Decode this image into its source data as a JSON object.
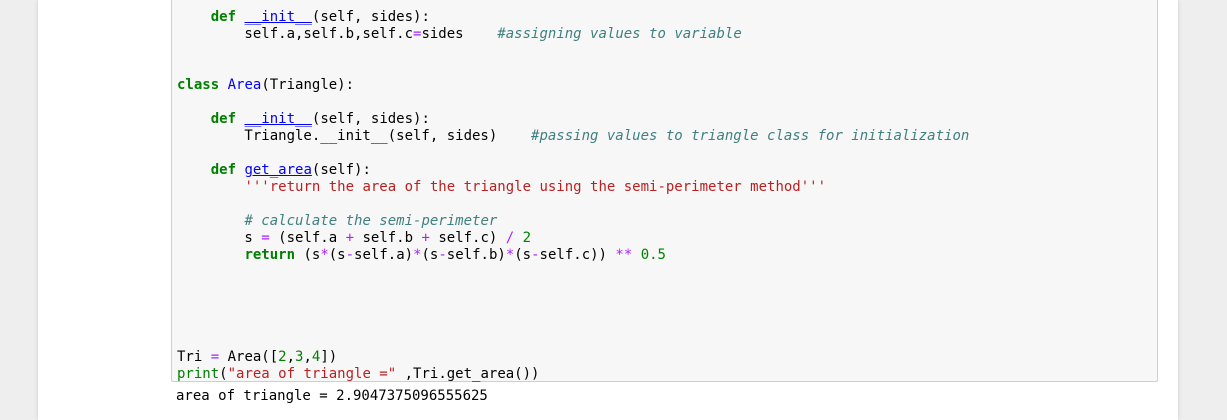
{
  "cell": {
    "lines": [
      {
        "segments": []
      },
      {
        "segments": [
          {
            "t": "    "
          },
          {
            "t": "def",
            "c": "kw"
          },
          {
            "t": " "
          },
          {
            "t": "__init__",
            "c": "fn"
          },
          {
            "t": "(self, sides):"
          }
        ]
      },
      {
        "segments": [
          {
            "t": "        self.a,self.b,self.c"
          },
          {
            "t": "=",
            "c": "op"
          },
          {
            "t": "sides    "
          },
          {
            "t": "#assigning values to variable",
            "c": "cm"
          }
        ]
      },
      {
        "segments": []
      },
      {
        "segments": []
      },
      {
        "segments": [
          {
            "t": "class",
            "c": "kw"
          },
          {
            "t": " "
          },
          {
            "t": "Area",
            "c": "nc"
          },
          {
            "t": "(Triangle):"
          }
        ]
      },
      {
        "segments": []
      },
      {
        "segments": [
          {
            "t": "    "
          },
          {
            "t": "def",
            "c": "kw"
          },
          {
            "t": " "
          },
          {
            "t": "__init__",
            "c": "fn"
          },
          {
            "t": "(self, sides):"
          }
        ]
      },
      {
        "segments": [
          {
            "t": "        Triangle.__init__(self, sides)    "
          },
          {
            "t": "#passing values to triangle class for initialization",
            "c": "cm"
          }
        ]
      },
      {
        "segments": []
      },
      {
        "segments": [
          {
            "t": "    "
          },
          {
            "t": "def",
            "c": "kw"
          },
          {
            "t": " "
          },
          {
            "t": "get_area",
            "c": "fn"
          },
          {
            "t": "(self):"
          }
        ]
      },
      {
        "segments": [
          {
            "t": "        "
          },
          {
            "t": "'''return the area of the triangle using the semi-perimeter method'''",
            "c": "st"
          }
        ]
      },
      {
        "segments": []
      },
      {
        "segments": [
          {
            "t": "        "
          },
          {
            "t": "# calculate the semi-perimeter",
            "c": "cm"
          }
        ]
      },
      {
        "segments": [
          {
            "t": "        s "
          },
          {
            "t": "=",
            "c": "op"
          },
          {
            "t": " (self.a "
          },
          {
            "t": "+",
            "c": "op"
          },
          {
            "t": " self.b "
          },
          {
            "t": "+",
            "c": "op"
          },
          {
            "t": " self.c) "
          },
          {
            "t": "/",
            "c": "op"
          },
          {
            "t": " "
          },
          {
            "t": "2",
            "c": "mi"
          }
        ]
      },
      {
        "segments": [
          {
            "t": "        "
          },
          {
            "t": "return",
            "c": "kw"
          },
          {
            "t": " (s"
          },
          {
            "t": "*",
            "c": "op"
          },
          {
            "t": "(s"
          },
          {
            "t": "-",
            "c": "op"
          },
          {
            "t": "self.a)"
          },
          {
            "t": "*",
            "c": "op"
          },
          {
            "t": "(s"
          },
          {
            "t": "-",
            "c": "op"
          },
          {
            "t": "self.b)"
          },
          {
            "t": "*",
            "c": "op"
          },
          {
            "t": "(s"
          },
          {
            "t": "-",
            "c": "op"
          },
          {
            "t": "self.c)) "
          },
          {
            "t": "**",
            "c": "op"
          },
          {
            "t": " "
          },
          {
            "t": "0.5",
            "c": "mi"
          }
        ]
      },
      {
        "segments": []
      },
      {
        "segments": []
      },
      {
        "segments": []
      },
      {
        "segments": []
      },
      {
        "segments": []
      },
      {
        "segments": [
          {
            "t": "Tri "
          },
          {
            "t": "=",
            "c": "op"
          },
          {
            "t": " Area(["
          },
          {
            "t": "2",
            "c": "mi"
          },
          {
            "t": ","
          },
          {
            "t": "3",
            "c": "mi"
          },
          {
            "t": ","
          },
          {
            "t": "4",
            "c": "mi"
          },
          {
            "t": "])"
          }
        ]
      },
      {
        "segments": [
          {
            "t": "print",
            "c": "bi"
          },
          {
            "t": "("
          },
          {
            "t": "\"area of triangle =\"",
            "c": "st"
          },
          {
            "t": " ,Tri.get_area())"
          }
        ]
      }
    ]
  },
  "output": {
    "text": "area of triangle = 2.9047375096555625"
  }
}
